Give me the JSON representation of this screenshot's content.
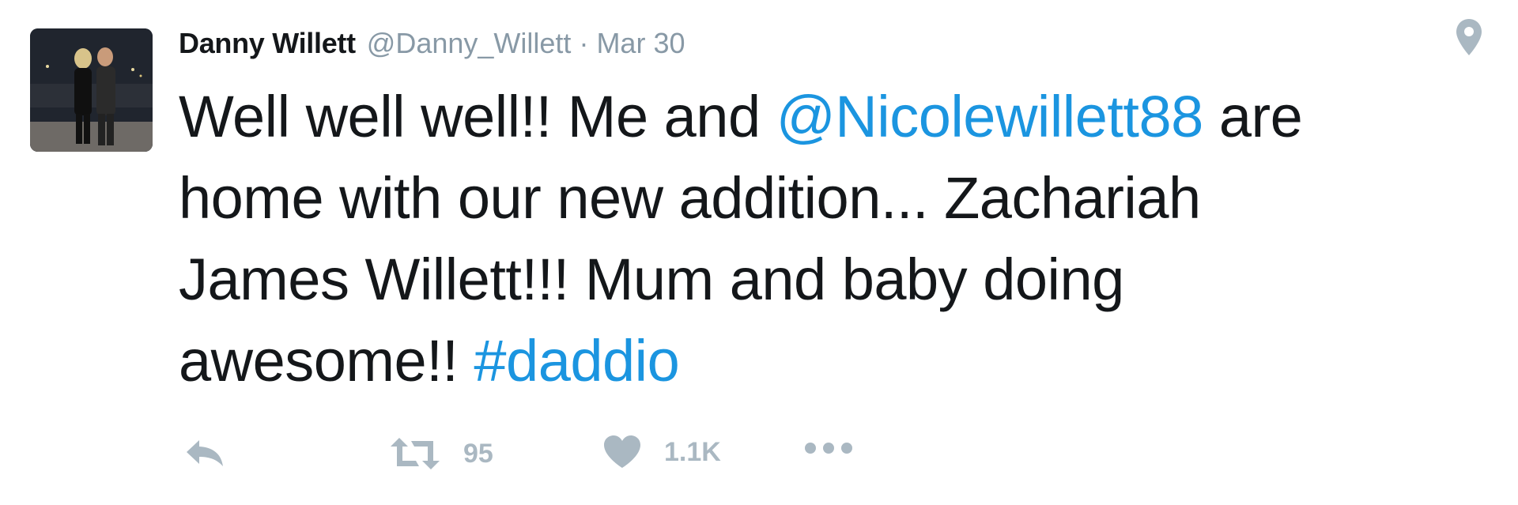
{
  "tweet": {
    "author_name": "Danny Willett",
    "author_handle": "@Danny_Willett",
    "separator": "·",
    "date": "Mar 30",
    "text_parts": {
      "line1_a": "Well well well!! Me and ",
      "mention": "@Nicolewillett88",
      "line1_b": " are",
      "line2": "home with our new addition... Zachariah",
      "line3": "James Willett!!! Mum and baby doing",
      "line4_a": "awesome!! ",
      "hashtag": "#daddio"
    },
    "retweet_count": "95",
    "like_count": "1.1K"
  },
  "icons": {
    "location": "location-pin-icon",
    "reply": "reply-icon",
    "retweet": "retweet-icon",
    "like": "heart-icon",
    "more": "more-dots-icon"
  },
  "colors": {
    "text": "#14171a",
    "muted": "#8899a6",
    "link": "#1b95e0",
    "icon": "#aab8c2"
  }
}
